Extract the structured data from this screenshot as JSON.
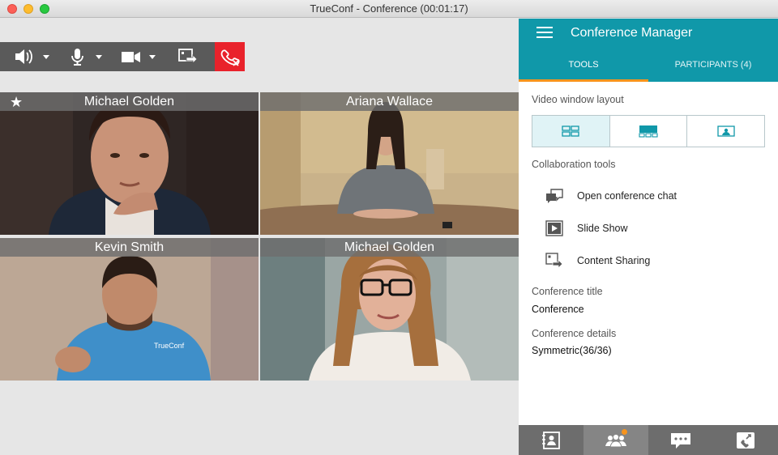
{
  "window": {
    "title": "TrueConf - Conference (00:01:17)"
  },
  "toolbar": {
    "icons": [
      "speaker-icon",
      "microphone-icon",
      "camera-icon",
      "content-share-icon",
      "hangup-icon"
    ]
  },
  "tiles": [
    {
      "name": "Michael Golden",
      "starred": true
    },
    {
      "name": "Ariana Wallace"
    },
    {
      "name": "Kevin Smith"
    },
    {
      "name": "Michael Golden"
    }
  ],
  "panel": {
    "title": "Conference Manager",
    "tabs": {
      "tools": "TOOLS",
      "participants": "PARTICIPANTS (4)"
    },
    "video_layout_label": "Video window layout",
    "collab_label": "Collaboration tools",
    "tools": [
      {
        "label": "Open conference chat",
        "icon": "chat-icon"
      },
      {
        "label": "Slide Show",
        "icon": "slideshow-icon"
      },
      {
        "label": "Content Sharing",
        "icon": "content-share-icon"
      }
    ],
    "conf_title_label": "Conference title",
    "conf_title_value": "Conference",
    "conf_details_label": "Conference details",
    "conf_details_value": "Symmetric(36/36)",
    "bottom_icons": [
      "contacts-icon",
      "participants-icon",
      "chat-icon",
      "call-icon"
    ]
  },
  "colors": {
    "accent": "#1098a9",
    "tab_underline": "#f7941d",
    "hangup": "#e9222b"
  }
}
